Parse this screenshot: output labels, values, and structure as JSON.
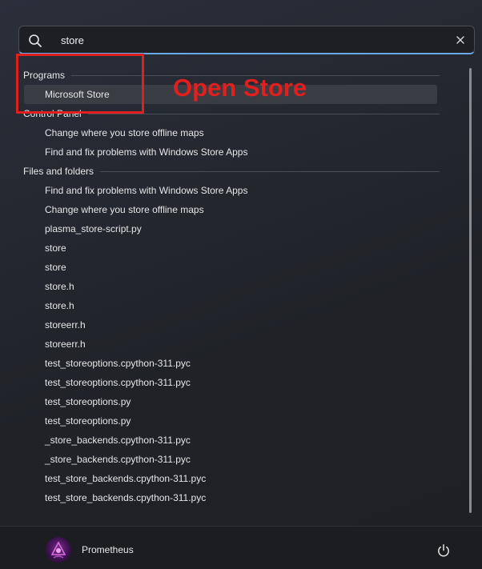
{
  "search": {
    "value": "store",
    "placeholder": "",
    "icon": "search-icon",
    "clear_icon": "close-icon"
  },
  "sections": [
    {
      "title": "Programs",
      "items": [
        "Microsoft Store"
      ]
    },
    {
      "title": "Control Panel",
      "items": [
        "Change where you store offline maps",
        "Find and fix problems with Windows Store Apps"
      ]
    },
    {
      "title": "Files and folders",
      "items": [
        "Find and fix problems with Windows Store Apps",
        "Change where you store offline maps",
        "plasma_store-script.py",
        "store",
        "store",
        "store.h",
        "store.h",
        "storeerr.h",
        "storeerr.h",
        "test_storeoptions.cpython-311.pyc",
        "test_storeoptions.cpython-311.pyc",
        "test_storeoptions.py",
        "test_storeoptions.py",
        "_store_backends.cpython-311.pyc",
        "_store_backends.cpython-311.pyc",
        "test_store_backends.cpython-311.pyc",
        "test_store_backends.cpython-311.pyc"
      ]
    }
  ],
  "annotation": {
    "text": "Open Store",
    "color": "#e0201f"
  },
  "footer": {
    "user_name": "Prometheus",
    "power_icon": "power-icon"
  },
  "colors": {
    "accent": "#6aa9e9",
    "selected_row": "#3a3d44"
  }
}
